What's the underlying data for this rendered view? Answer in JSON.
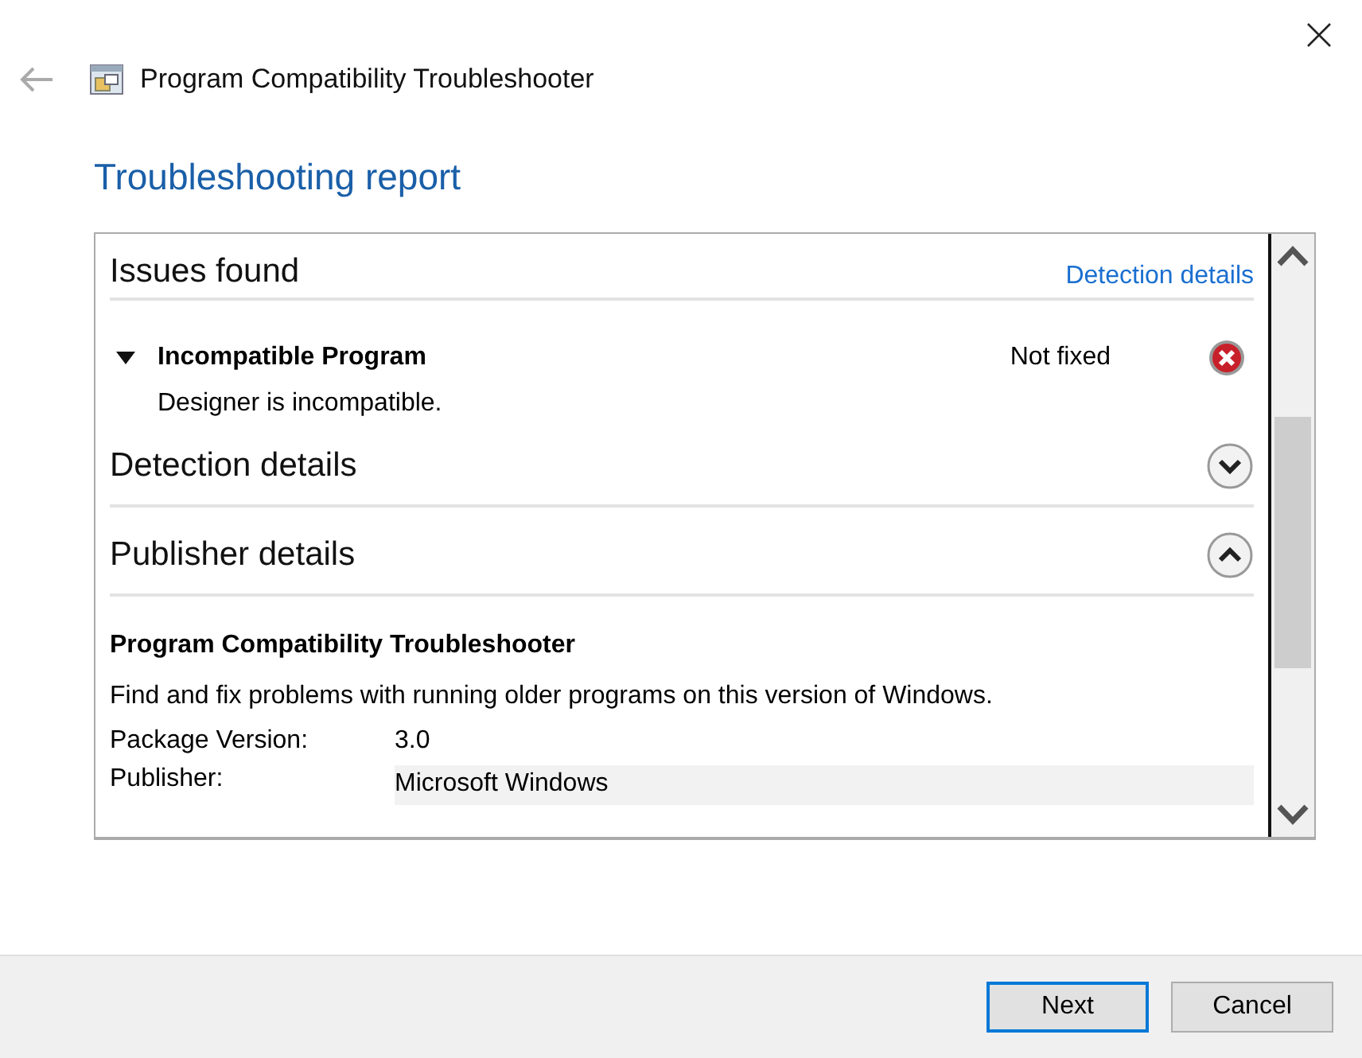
{
  "window": {
    "title": "Program Compatibility Troubleshooter"
  },
  "heading": "Troubleshooting report",
  "issues": {
    "title": "Issues found",
    "link": "Detection details",
    "items": [
      {
        "title": "Incompatible Program",
        "status": "Not fixed",
        "expanded": true,
        "fixed": false,
        "description": "Designer is incompatible."
      }
    ]
  },
  "sections": [
    {
      "title": "Detection details",
      "expanded": false
    },
    {
      "title": "Publisher details",
      "expanded": true
    }
  ],
  "publisher": {
    "name": "Program Compatibility Troubleshooter",
    "description": "Find and fix problems with running older programs on this version of Windows.",
    "properties": [
      {
        "label": "Package Version:",
        "value": "3.0",
        "selected": false
      },
      {
        "label": "Publisher:",
        "value": "Microsoft Windows",
        "selected": true
      }
    ]
  },
  "buttons": [
    {
      "label": "Next",
      "default": true
    },
    {
      "label": "Cancel",
      "default": false
    }
  ]
}
